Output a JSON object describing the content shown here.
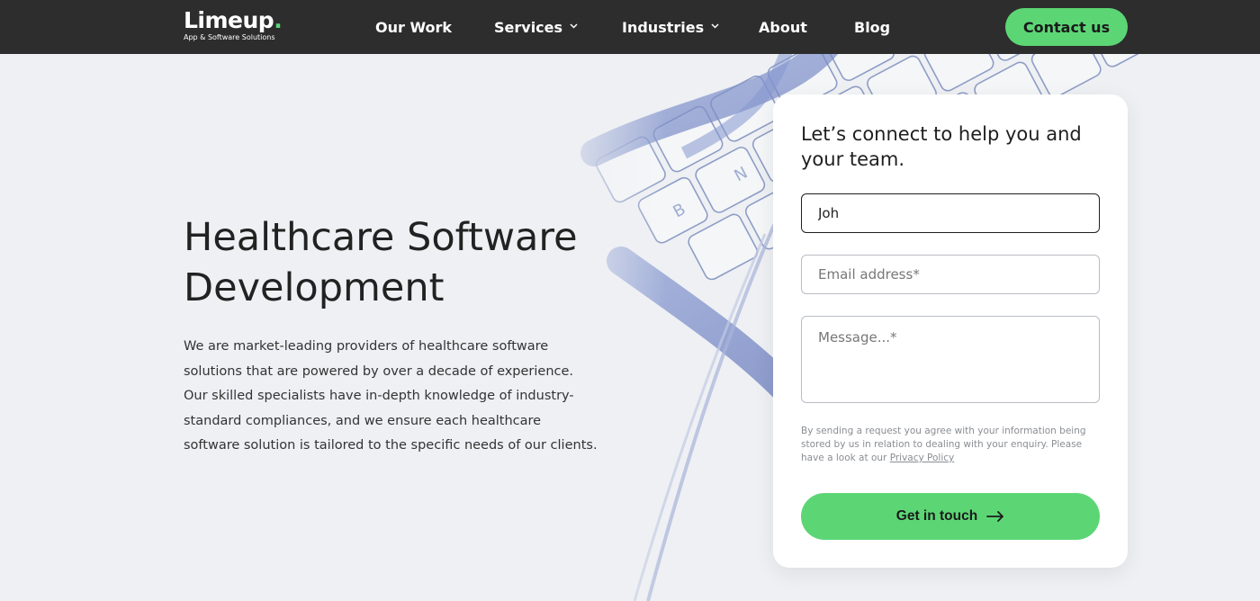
{
  "header": {
    "logo_name": "Limeup",
    "logo_dot": ".",
    "logo_tagline": "App & Software Solutions",
    "nav": [
      {
        "label": "Our Work"
      },
      {
        "label": "Services"
      },
      {
        "label": "Industries"
      },
      {
        "label": "About"
      },
      {
        "label": "Blog"
      }
    ],
    "contact_label": "Contact us"
  },
  "hero": {
    "title_line1": "Healthcare Software",
    "title_line2": "Development",
    "description": "We are market-leading providers of healthcare software solutions that are powered by over a decade of experience. Our skilled specialists have in-depth knowledge of industry-standard compliances, and we ensure each healthcare software solution is tailored to the specific needs of our clients."
  },
  "form": {
    "title": "Let’s connect to help you and your team.",
    "name_value": "Joh",
    "email_placeholder": "Email address*",
    "message_placeholder": "Message...*",
    "privacy_text": "By sending a request you agree with your information being stored by us in relation to dealing with your enquiry. Please have a look at our ",
    "privacy_link": "Privacy Policy",
    "submit_label": "Get in touch"
  },
  "colors": {
    "nav_bg": "#2d2d2d",
    "accent": "#5cd675",
    "page_bg": "#eef0f3"
  },
  "icons": {
    "services_dropdown": "chevron-down-icon",
    "industries_dropdown": "chevron-down-icon",
    "submit_arrow": "arrow-right-icon"
  }
}
